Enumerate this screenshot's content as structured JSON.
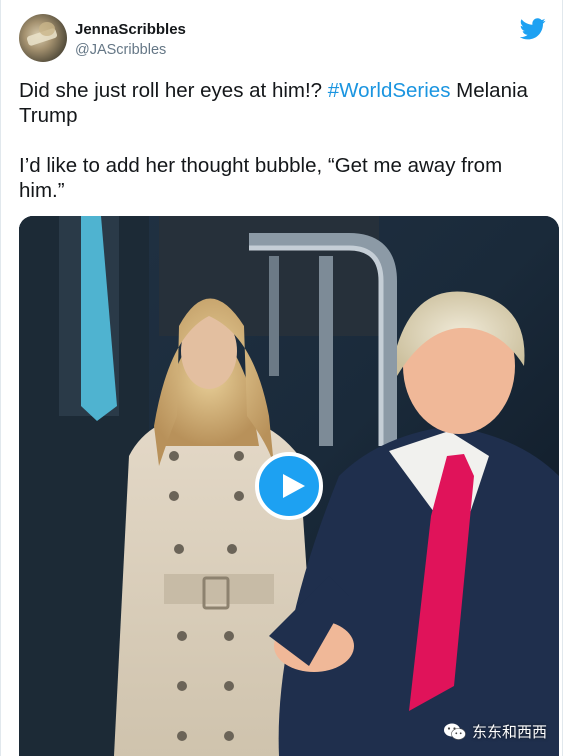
{
  "user": {
    "display_name": "JennaScribbles",
    "handle": "@JAScribbles",
    "avatar_icon": "user-avatar"
  },
  "brand": {
    "icon": "twitter-bird-icon",
    "color": "#1da1f2"
  },
  "tweet": {
    "text_before_hashtag": "Did she just roll her eyes at him!? ",
    "hashtag": "#WorldSeries",
    "text_after_hashtag": " Melania Trump",
    "paragraph_2": "I’d like to add her thought bubble, “Get me away from him.”",
    "hashtag_color": "#1b95e0"
  },
  "media": {
    "type": "video",
    "play_icon": "play-icon",
    "watermark_text": "东东和西西",
    "watermark_icon": "wechat-icon"
  }
}
